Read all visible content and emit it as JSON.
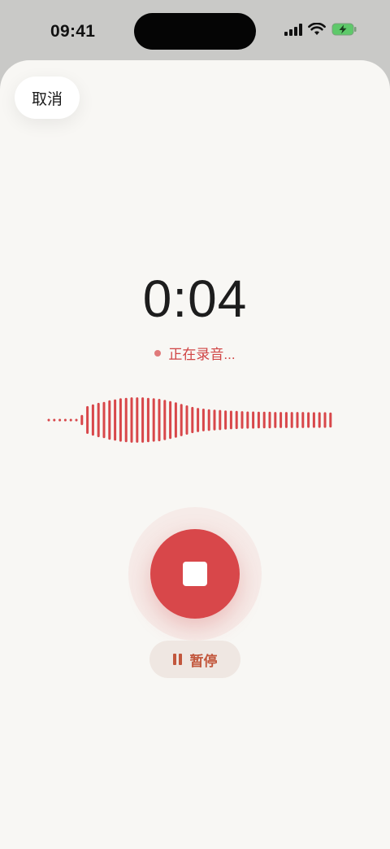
{
  "status_bar": {
    "time": "09:41",
    "icons": [
      "signal-icon",
      "wifi-icon",
      "battery-charging-icon"
    ]
  },
  "sheet": {
    "cancel_label": "取消",
    "timer": "0:04",
    "recording_status": "正在录音...",
    "pause_label": "暂停",
    "stop_icon": "stop-icon"
  },
  "colors": {
    "accent": "#d8474a",
    "pause_text": "#c2573d",
    "pause_bg": "#efe7e2",
    "sheet_bg": "#f8f7f4",
    "status_bg": "#c9c9c7"
  },
  "waveform": {
    "amplitudes": [
      0.05,
      0.05,
      0.05,
      0.05,
      0.05,
      0.05,
      0.2,
      0.55,
      0.62,
      0.68,
      0.72,
      0.78,
      0.82,
      0.86,
      0.88,
      0.9,
      0.9,
      0.9,
      0.88,
      0.86,
      0.84,
      0.8,
      0.75,
      0.7,
      0.64,
      0.58,
      0.52,
      0.48,
      0.45,
      0.43,
      0.41,
      0.4,
      0.38,
      0.37,
      0.36,
      0.35,
      0.34,
      0.34,
      0.33,
      0.33,
      0.33,
      0.32,
      0.32,
      0.32,
      0.32,
      0.32,
      0.32,
      0.31,
      0.31,
      0.31,
      0.31,
      0.3
    ]
  }
}
